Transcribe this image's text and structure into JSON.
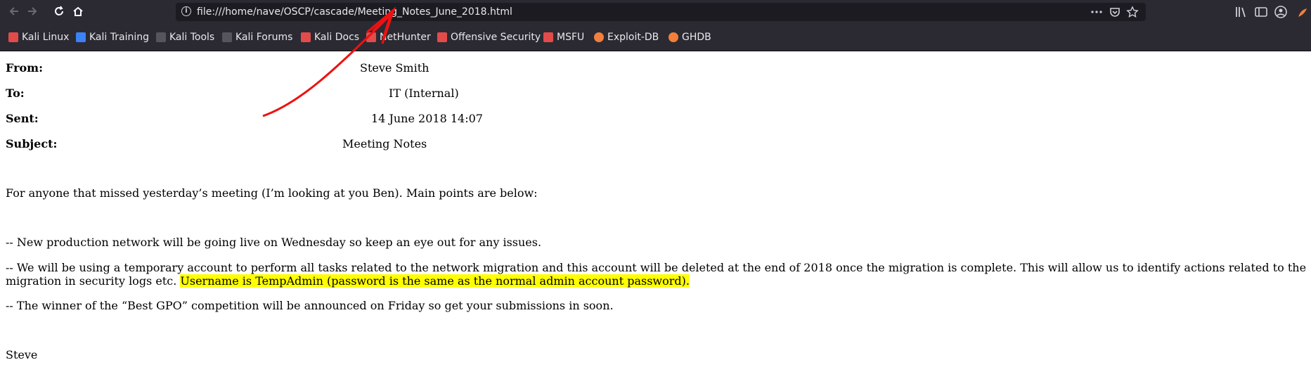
{
  "browser": {
    "url": "file:///home/nave/OSCP/cascade/Meeting_Notes_June_2018.html",
    "accent": "#2b2a33"
  },
  "bookmarks": [
    {
      "label": "Kali Linux",
      "icon": "kali-icon",
      "color": "#e34b4b"
    },
    {
      "label": "Kali Training",
      "icon": "kali-training-icon",
      "color": "#3b82f6"
    },
    {
      "label": "Kali Tools",
      "icon": "kali-tools-icon",
      "color": "#cfcfd6"
    },
    {
      "label": "Kali Forums",
      "icon": "kali-forums-icon",
      "color": "#cfcfd6"
    },
    {
      "label": "Kali Docs",
      "icon": "kali-docs-icon",
      "color": "#e34b4b"
    },
    {
      "label": "NetHunter",
      "icon": "nethunter-icon",
      "color": "#e34b4b"
    },
    {
      "label": "Offensive Security",
      "icon": "offsec-icon",
      "color": "#e34b4b"
    },
    {
      "label": "MSFU",
      "icon": "msfu-icon",
      "color": "#e34b4b"
    },
    {
      "label": "Exploit-DB",
      "icon": "exploitdb-icon",
      "color": "#f0803c"
    },
    {
      "label": "GHDB",
      "icon": "ghdb-icon",
      "color": "#f0803c"
    }
  ],
  "email": {
    "from_label": "From:",
    "from_value": "Steve Smith",
    "to_label": "To:",
    "to_value": "IT (Internal)",
    "sent_label": "Sent:",
    "sent_value": "14 June 2018 14:07",
    "subject_label": "Subject:",
    "subject_value": "Meeting Notes",
    "intro": "For anyone that missed yesterday’s meeting (I’m looking at you Ben). Main points are below:",
    "point1": "-- New production network will be going live on Wednesday so keep an eye out for any issues.",
    "point2_line1": "-- We will be using a temporary account to perform all tasks related to the network migration and this account will be deleted at the end of 2018 once the migration is complete. This will allow us to identify actions related to the",
    "point2_line2_start": "migration in security logs etc. ",
    "point2_highlight": "Username is TempAdmin (password is the same as the normal admin account password).",
    "point3": "-- The winner of the “Best GPO” competition will be announced on Friday so get your submissions in soon.",
    "signature": "Steve"
  },
  "annotation": {
    "arrow_color": "#ee1111",
    "highlight_color": "#ffff00"
  }
}
